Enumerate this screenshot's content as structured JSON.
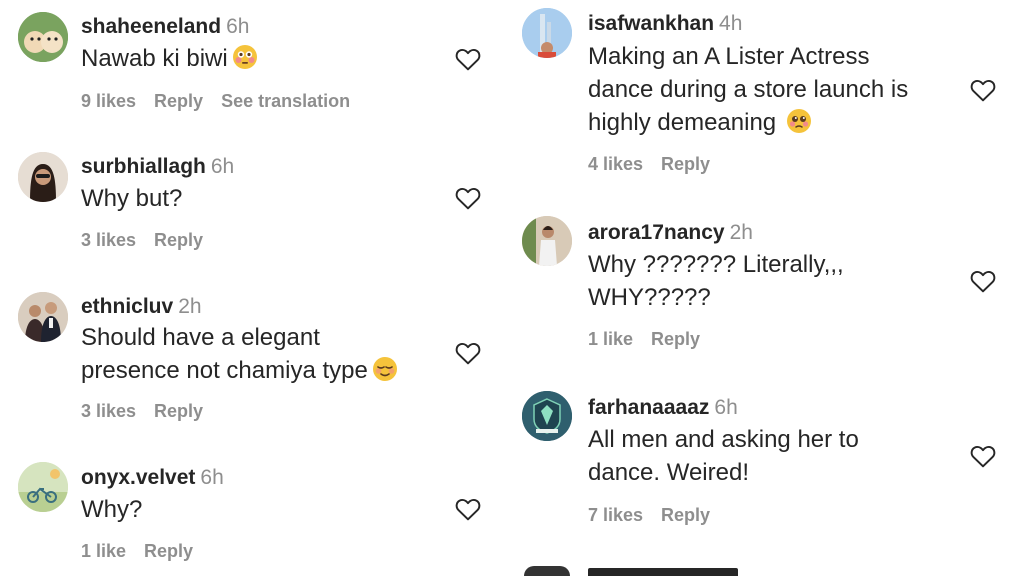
{
  "colors": {
    "text": "#262626",
    "muted": "#8e8e8e",
    "heart_stroke": "#262626"
  },
  "left_comments": [
    {
      "username": "shaheeneland",
      "time": "6h",
      "text": "Nawab ki biwi",
      "emoji": "flushed-face-icon",
      "likes": "9 likes",
      "reply": "Reply",
      "translate": "See translation"
    },
    {
      "username": "surbhiallagh",
      "time": "6h",
      "text": "Why but?",
      "likes": "3 likes",
      "reply": "Reply"
    },
    {
      "username": "ethnicluv",
      "time": "2h",
      "text_line1": "Should have a elegant",
      "text_line2": "presence not chamiya type",
      "emoji": "relieved-face-icon",
      "likes": "3 likes",
      "reply": "Reply"
    },
    {
      "username": "onyx.velvet",
      "time": "6h",
      "text": "Why?",
      "likes": "1 like",
      "reply": "Reply"
    }
  ],
  "right_comments": [
    {
      "username": "isafwankhan",
      "time": "4h",
      "text_line1": "Making an A Lister Actress",
      "text_line2": "dance during a store launch is",
      "text_line3": "highly demeaning",
      "emoji": "pleading-face-icon",
      "likes": "4 likes",
      "reply": "Reply"
    },
    {
      "username": "arora17nancy",
      "time": "2h",
      "text_line1": "Why ??????? Literally,,,",
      "text_line2": "WHY?????",
      "likes": "1 like",
      "reply": "Reply"
    },
    {
      "username": "farhanaaaaz",
      "time": "6h",
      "text_line1": "All men and asking her to",
      "text_line2": "dance. Weired!",
      "likes": "7 likes",
      "reply": "Reply"
    }
  ]
}
